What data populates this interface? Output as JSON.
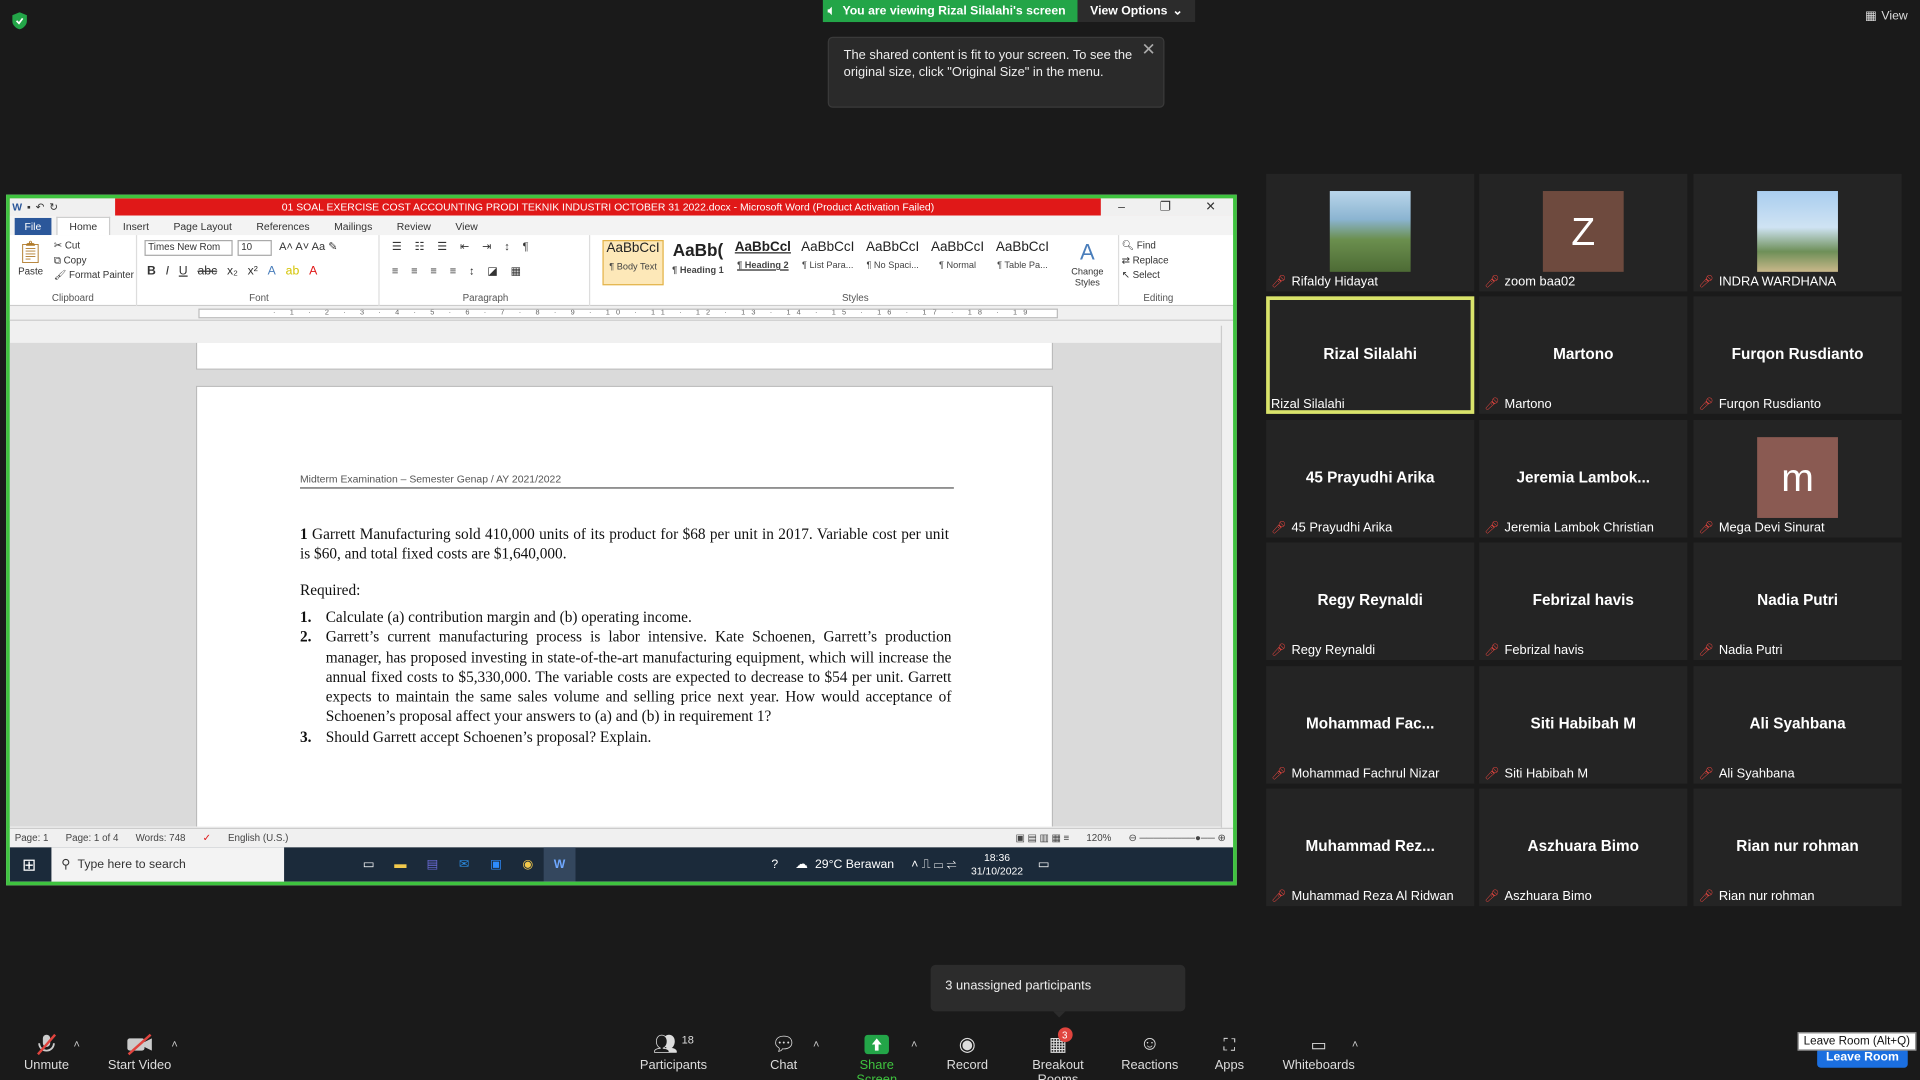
{
  "banner": {
    "viewing": "You are viewing Rizal Silalahi's screen",
    "view_options": "View Options",
    "tooltip": "The shared content is fit to your screen. To see the original size, click \"Original Size\" in the menu.",
    "view": "View"
  },
  "word": {
    "title": "01 SOAL EXERCISE COST ACCOUNTING PRODI TEKNIK INDUSTRI OCTOBER 31 2022.docx - Microsoft Word (Product Activation Failed)",
    "tabs": [
      "File",
      "Home",
      "Insert",
      "Page Layout",
      "References",
      "Mailings",
      "Review",
      "View"
    ],
    "clipboard": {
      "paste": "Paste",
      "cut": "Cut",
      "copy": "Copy",
      "format_painter": "Format Painter",
      "label": "Clipboard"
    },
    "font": {
      "name": "Times New Rom",
      "size": "10",
      "label": "Font"
    },
    "paragraph_label": "Paragraph",
    "styles": [
      {
        "preview": "AaBbCcI",
        "name": "¶ Body Text"
      },
      {
        "preview": "AaBb(",
        "name": "¶ Heading 1"
      },
      {
        "preview": "AaBbCcl",
        "name": "¶ Heading 2"
      },
      {
        "preview": "AaBbCcI",
        "name": "¶ List Para..."
      },
      {
        "preview": "AaBbCcI",
        "name": "¶ No Spaci..."
      },
      {
        "preview": "AaBbCcI",
        "name": "¶ Normal"
      },
      {
        "preview": "AaBbCcI",
        "name": "¶ Table Pa..."
      }
    ],
    "styles_label": "Styles",
    "change_styles": "Change Styles",
    "editing": {
      "find": "Find",
      "replace": "Replace",
      "select": "Select",
      "label": "Editing"
    },
    "doc": {
      "header": "Midterm Examination – Semester Genap / AY 2021/2022",
      "q1_num": "1",
      "q1": "Garrett Manufacturing sold 410,000 units of its product for $68 per unit in 2017. Variable cost per unit is $60, and total fixed costs are $1,640,000.",
      "required": "Required:",
      "items": [
        {
          "n": "1.",
          "t": "Calculate (a) contribution margin and (b) operating income."
        },
        {
          "n": "2.",
          "t": "Garrett’s current manufacturing process is labor intensive. Kate Schoenen, Garrett’s production manager, has proposed investing in state-of-the-art manufacturing equipment, which will increase the annual fixed costs to $5,330,000. The variable costs are expected to decrease to $54 per unit. Garrett expects to maintain the same sales volume and selling price next year. How would acceptance of Schoenen’s proposal affect your answers to (a) and (b) in requirement 1?"
        },
        {
          "n": "3.",
          "t": "Should Garrett accept Schoenen’s proposal? Explain."
        }
      ]
    },
    "status": {
      "page": "Page: 1",
      "page_of": "Page: 1 of 4",
      "words": "Words: 748",
      "lang": "English (U.S.)",
      "zoom": "120%"
    }
  },
  "taskbar": {
    "search": "Type here to search",
    "weather": "29°C  Berawan",
    "time": "18:36",
    "date": "31/10/2022"
  },
  "participants": [
    {
      "name": "Rifaldy Hidayat",
      "label": "Rifaldy Hidayat",
      "type": "photo",
      "muted": true
    },
    {
      "name": "zoom baa02",
      "label": "zoom baa02",
      "type": "letter",
      "letter": "Z",
      "color": "#6e4a3e",
      "muted": true
    },
    {
      "name": "INDRA WARDHANA",
      "label": "INDRA WARDHANA",
      "type": "photo2",
      "muted": true
    },
    {
      "name": "Rizal Silalahi",
      "label": "Rizal Silalahi",
      "type": "name",
      "muted": false,
      "active": true
    },
    {
      "name": "Martono",
      "label": "Martono",
      "type": "name",
      "muted": true
    },
    {
      "name": "Furqon Rusdianto",
      "label": "Furqon Rusdianto",
      "type": "name",
      "muted": true
    },
    {
      "name": "45 Prayudhi Arika",
      "label": "45 Prayudhi Arika",
      "type": "name",
      "muted": true
    },
    {
      "name": "Jeremia  Lambok...",
      "label": "Jeremia Lambok Christian",
      "type": "name",
      "muted": true
    },
    {
      "name": "Mega Devi Sinurat",
      "label": "Mega Devi Sinurat",
      "type": "letter",
      "letter": "m",
      "color": "#8a5a52",
      "muted": true
    },
    {
      "name": "Regy Reynaldi",
      "label": "Regy Reynaldi",
      "type": "name",
      "muted": true
    },
    {
      "name": "Febrizal havis",
      "label": "Febrizal havis",
      "type": "name",
      "muted": true
    },
    {
      "name": "Nadia Putri",
      "label": "Nadia Putri",
      "type": "name",
      "muted": true
    },
    {
      "name": "Mohammad  Fac...",
      "label": "Mohammad Fachrul Nizar",
      "type": "name",
      "muted": true
    },
    {
      "name": "Siti Habibah M",
      "label": "Siti Habibah M",
      "type": "name",
      "muted": true
    },
    {
      "name": "Ali Syahbana",
      "label": "Ali Syahbana",
      "type": "name",
      "muted": true
    },
    {
      "name": "Muhammad  Rez...",
      "label": "Muhammad Reza Al Ridwan",
      "type": "name",
      "muted": true
    },
    {
      "name": "Aszhuara Bimo",
      "label": "Aszhuara Bimo",
      "type": "name",
      "muted": true
    },
    {
      "name": "Rian nur rohman",
      "label": "Rian nur rohman",
      "type": "name",
      "muted": true
    }
  ],
  "popup": {
    "unassigned": "3 unassigned participants"
  },
  "toolbar": {
    "unmute": "Unmute",
    "start_video": "Start Video",
    "participants": "Participants",
    "participants_count": "18",
    "chat": "Chat",
    "share_screen": "Share Screen",
    "record": "Record",
    "breakout": "Breakout Rooms",
    "breakout_badge": "3",
    "reactions": "Reactions",
    "apps": "Apps",
    "whiteboards": "Whiteboards",
    "leave_tip": "Leave Room (Alt+Q)",
    "leave": "Leave Room"
  },
  "colors": {
    "share_border": "#3fc33f",
    "banner_green": "#23a548",
    "active_tile": "#d9e36a",
    "leave_blue": "#1b6fe0"
  }
}
